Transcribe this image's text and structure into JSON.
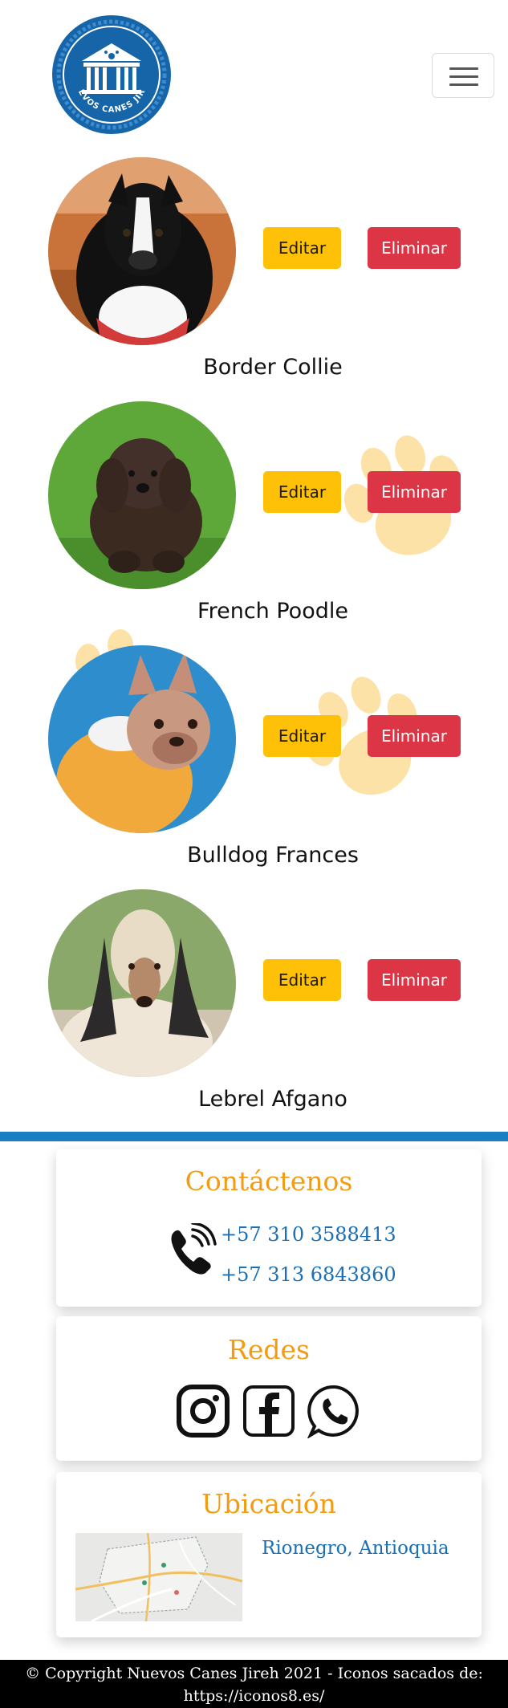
{
  "brand": {
    "logo_text": "NUEVOS CANES JIREH",
    "logo_color": "#1565a8"
  },
  "nav": {
    "toggler": "menu"
  },
  "dogs": [
    {
      "name": "Border Collie",
      "edit_label": "Editar",
      "delete_label": "Eliminar"
    },
    {
      "name": "French Poodle",
      "edit_label": "Editar",
      "delete_label": "Eliminar"
    },
    {
      "name": "Bulldog Frances",
      "edit_label": "Editar",
      "delete_label": "Eliminar"
    },
    {
      "name": "Lebrel Afgano",
      "edit_label": "Editar",
      "delete_label": "Eliminar"
    }
  ],
  "contact": {
    "title": "Contáctenos",
    "phones": [
      "+57 310 3588413",
      "+57 313 6843860"
    ]
  },
  "social": {
    "title": "Redes",
    "icons": [
      "instagram-icon",
      "facebook-icon",
      "whatsapp-icon"
    ]
  },
  "location": {
    "title": "Ubicación",
    "place": "Rionegro, Antioquia"
  },
  "footer": {
    "line1": "© Copyright Nuevos Canes Jireh 2021 - Iconos sacados de:",
    "line2": "https://iconos8.es/"
  },
  "colors": {
    "accent_blue": "#1a7ec2",
    "heading_orange": "#f39c12",
    "edit_yellow": "#ffc107",
    "delete_red": "#dc3545",
    "paw": "#fde2a8"
  }
}
